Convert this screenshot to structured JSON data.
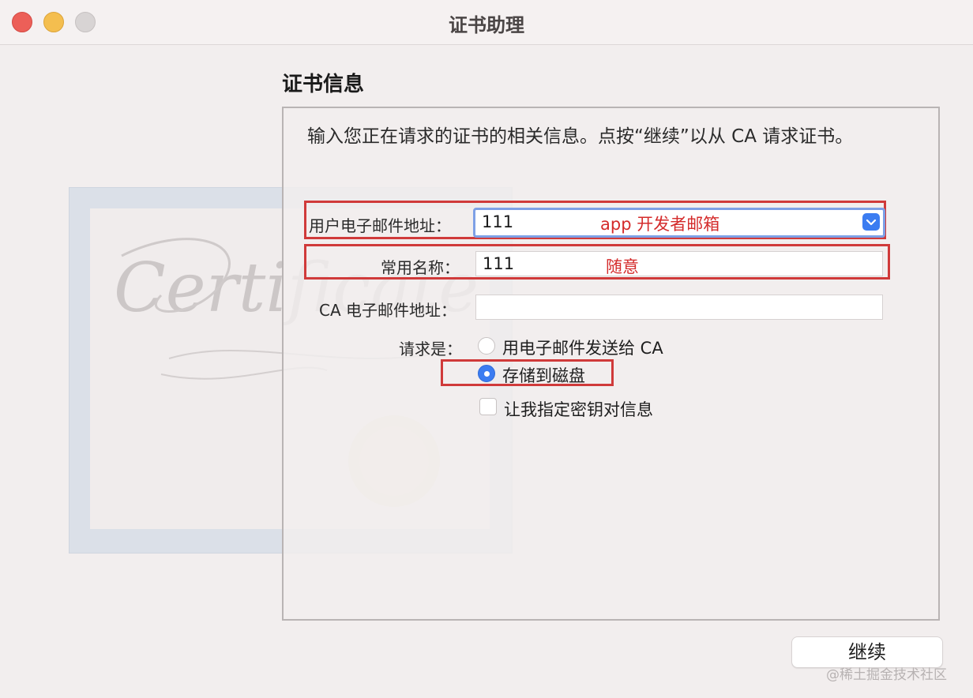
{
  "window": {
    "title": "证书助理"
  },
  "section_title": "证书信息",
  "intro_text": "输入您正在请求的证书的相关信息。点按“继续”以从 CA 请求证书。",
  "form": {
    "user_email": {
      "label": "用户电子邮件地址：",
      "value": "111",
      "annotation": "app 开发者邮箱"
    },
    "common_name": {
      "label": "常用名称：",
      "value": "111",
      "annotation": "随意"
    },
    "ca_email": {
      "label": "CA 电子邮件地址：",
      "value": ""
    },
    "request": {
      "label": "请求是：",
      "options": [
        {
          "label": "用电子邮件发送给 CA",
          "selected": false
        },
        {
          "label": "存储到磁盘",
          "selected": true
        }
      ]
    },
    "custom_key": {
      "label": "让我指定密钥对信息",
      "checked": false
    }
  },
  "buttons": {
    "continue": "继续"
  },
  "watermark": "@稀土掘金技术社区",
  "certificate_art_text": "Certificate",
  "colors": {
    "accent": "#3b7cf1",
    "annotation": "#d42b2b"
  }
}
